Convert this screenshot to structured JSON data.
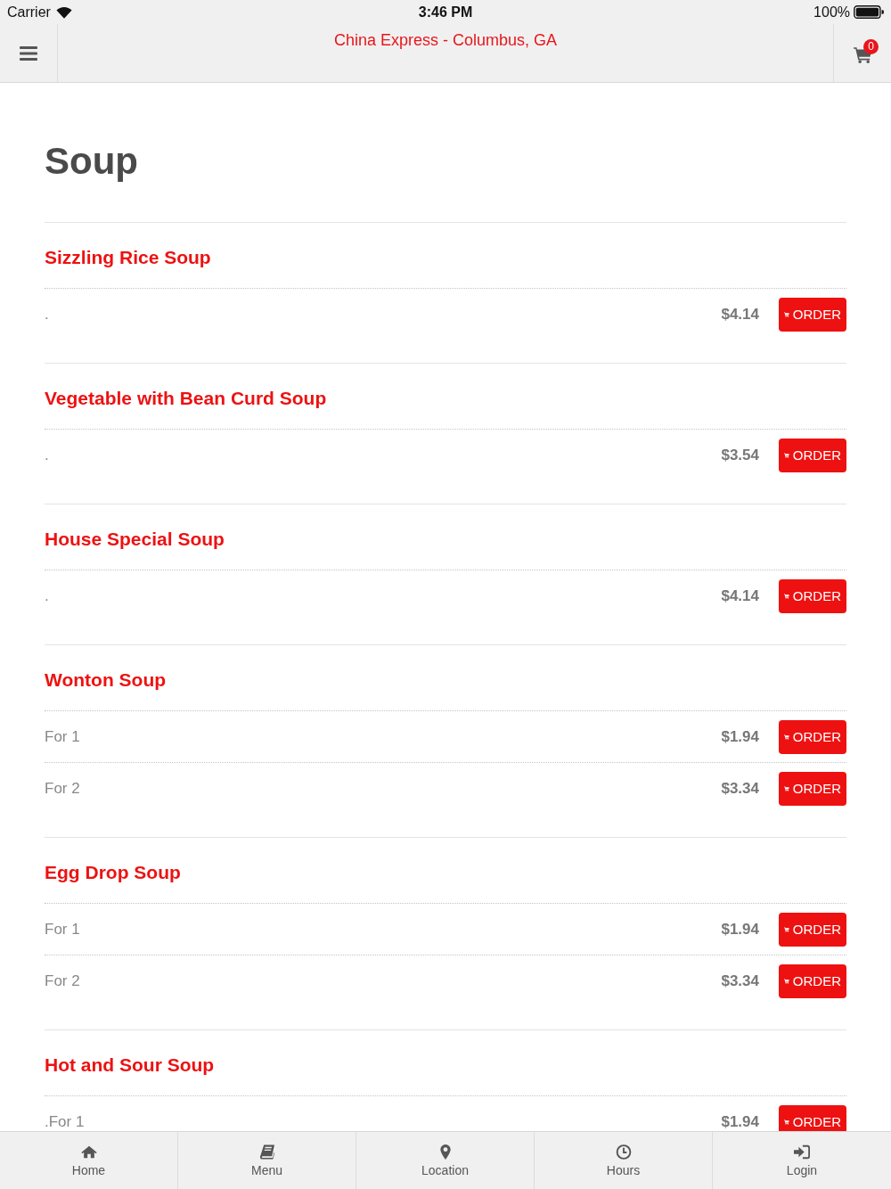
{
  "status_bar": {
    "carrier": "Carrier",
    "time": "3:46 PM",
    "battery": "100%"
  },
  "nav": {
    "title": "China Express - Columbus, GA",
    "cart_count": "0"
  },
  "page_title": "Soup",
  "items": [
    {
      "name": "Sizzling Rice Soup",
      "options": [
        {
          "label": ".",
          "price": "$4.14",
          "button": "ORDER"
        }
      ]
    },
    {
      "name": "Vegetable with Bean Curd Soup",
      "options": [
        {
          "label": ".",
          "price": "$3.54",
          "button": "ORDER"
        }
      ]
    },
    {
      "name": "House Special Soup",
      "options": [
        {
          "label": ".",
          "price": "$4.14",
          "button": "ORDER"
        }
      ]
    },
    {
      "name": "Wonton Soup",
      "options": [
        {
          "label": "For 1",
          "price": "$1.94",
          "button": "ORDER"
        },
        {
          "label": "For 2",
          "price": "$3.34",
          "button": "ORDER"
        }
      ]
    },
    {
      "name": "Egg Drop Soup",
      "options": [
        {
          "label": "For 1",
          "price": "$1.94",
          "button": "ORDER"
        },
        {
          "label": "For 2",
          "price": "$3.34",
          "button": "ORDER"
        }
      ]
    },
    {
      "name": "Hot and Sour Soup",
      "options": [
        {
          "label": ".For 1",
          "price": "$1.94",
          "button": "ORDER"
        }
      ]
    }
  ],
  "tabs": [
    {
      "label": "Home",
      "kind": "home"
    },
    {
      "label": "Menu",
      "kind": "menu"
    },
    {
      "label": "Location",
      "kind": "location"
    },
    {
      "label": "Hours",
      "kind": "hours"
    },
    {
      "label": "Login",
      "kind": "login"
    }
  ]
}
